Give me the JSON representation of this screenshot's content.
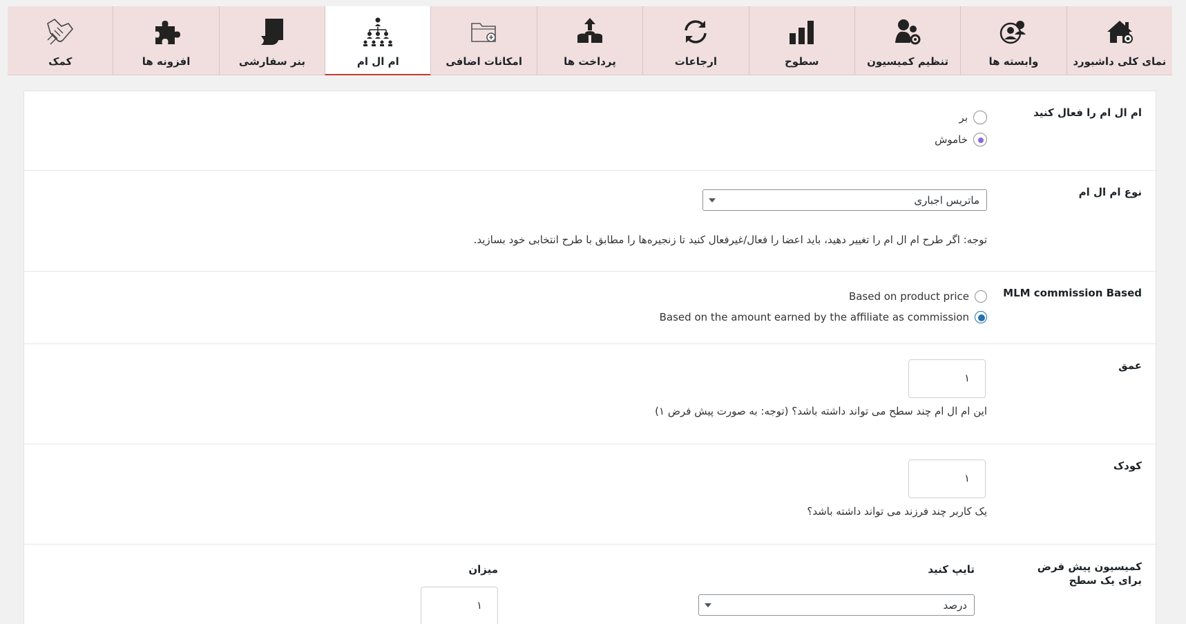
{
  "tabs": [
    {
      "label": "نمای کلی داشبورد",
      "icon": "home-icon",
      "active": false
    },
    {
      "label": "وابسته ها",
      "icon": "affiliates-icon",
      "active": false
    },
    {
      "label": "تنظیم کمیسیون",
      "icon": "commission-settings-icon",
      "active": false
    },
    {
      "label": "سطوح",
      "icon": "bar-chart-icon",
      "active": false
    },
    {
      "label": "ارجاعات",
      "icon": "refresh-icon",
      "active": false
    },
    {
      "label": "پرداخت ها",
      "icon": "payout-icon",
      "active": false
    },
    {
      "label": "امکانات اضافی",
      "icon": "folder-add-icon",
      "active": false
    },
    {
      "label": "ام ال ام",
      "icon": "hierarchy-icon",
      "active": true
    },
    {
      "label": "بنر سفارشی",
      "icon": "banner-icon",
      "active": false
    },
    {
      "label": "افزونه ها",
      "icon": "puzzle-icon",
      "active": false
    },
    {
      "label": "کمک",
      "icon": "help-handshake-icon",
      "active": false
    }
  ],
  "enable": {
    "label": "ام ال ام را فعال کنید",
    "on_label": "بر",
    "off_label": "خاموش",
    "selected": "off"
  },
  "type": {
    "label": "نوع ام ال ام",
    "selected": "ماتریس اجباری",
    "note": "توجه: اگر طرح ام ال ام را تغییر دهید، باید اعضا را فعال/غیرفعال کنید تا زنجیره‌ها را مطابق با طرح انتخابی خود بسازید."
  },
  "commission_based": {
    "label": "MLM commission Based",
    "option_price": "Based on product price",
    "option_earned": "Based on the amount earned by the affiliate as commission",
    "selected": "earned"
  },
  "depth": {
    "label": "عمق",
    "value": "۱",
    "note": "این ام ال ام چند سطح می تواند داشته باشد؟ (توجه: به صورت پیش فرض ۱)"
  },
  "child": {
    "label": "کودک",
    "value": "۱",
    "note": "یک کاربر چند فرزند می تواند داشته باشد؟"
  },
  "default_commission": {
    "label": "کمیسیون پیش فرض برای یک سطح",
    "type_label": "تایپ کنید",
    "type_value": "درصد",
    "amount_label": "میزان",
    "amount_value": "۱"
  },
  "colors": {
    "tab_bg": "#f1dfe0",
    "active_underline": "#c0392b",
    "radio_purple": "#8f69d6",
    "radio_blue": "#2271b1"
  }
}
